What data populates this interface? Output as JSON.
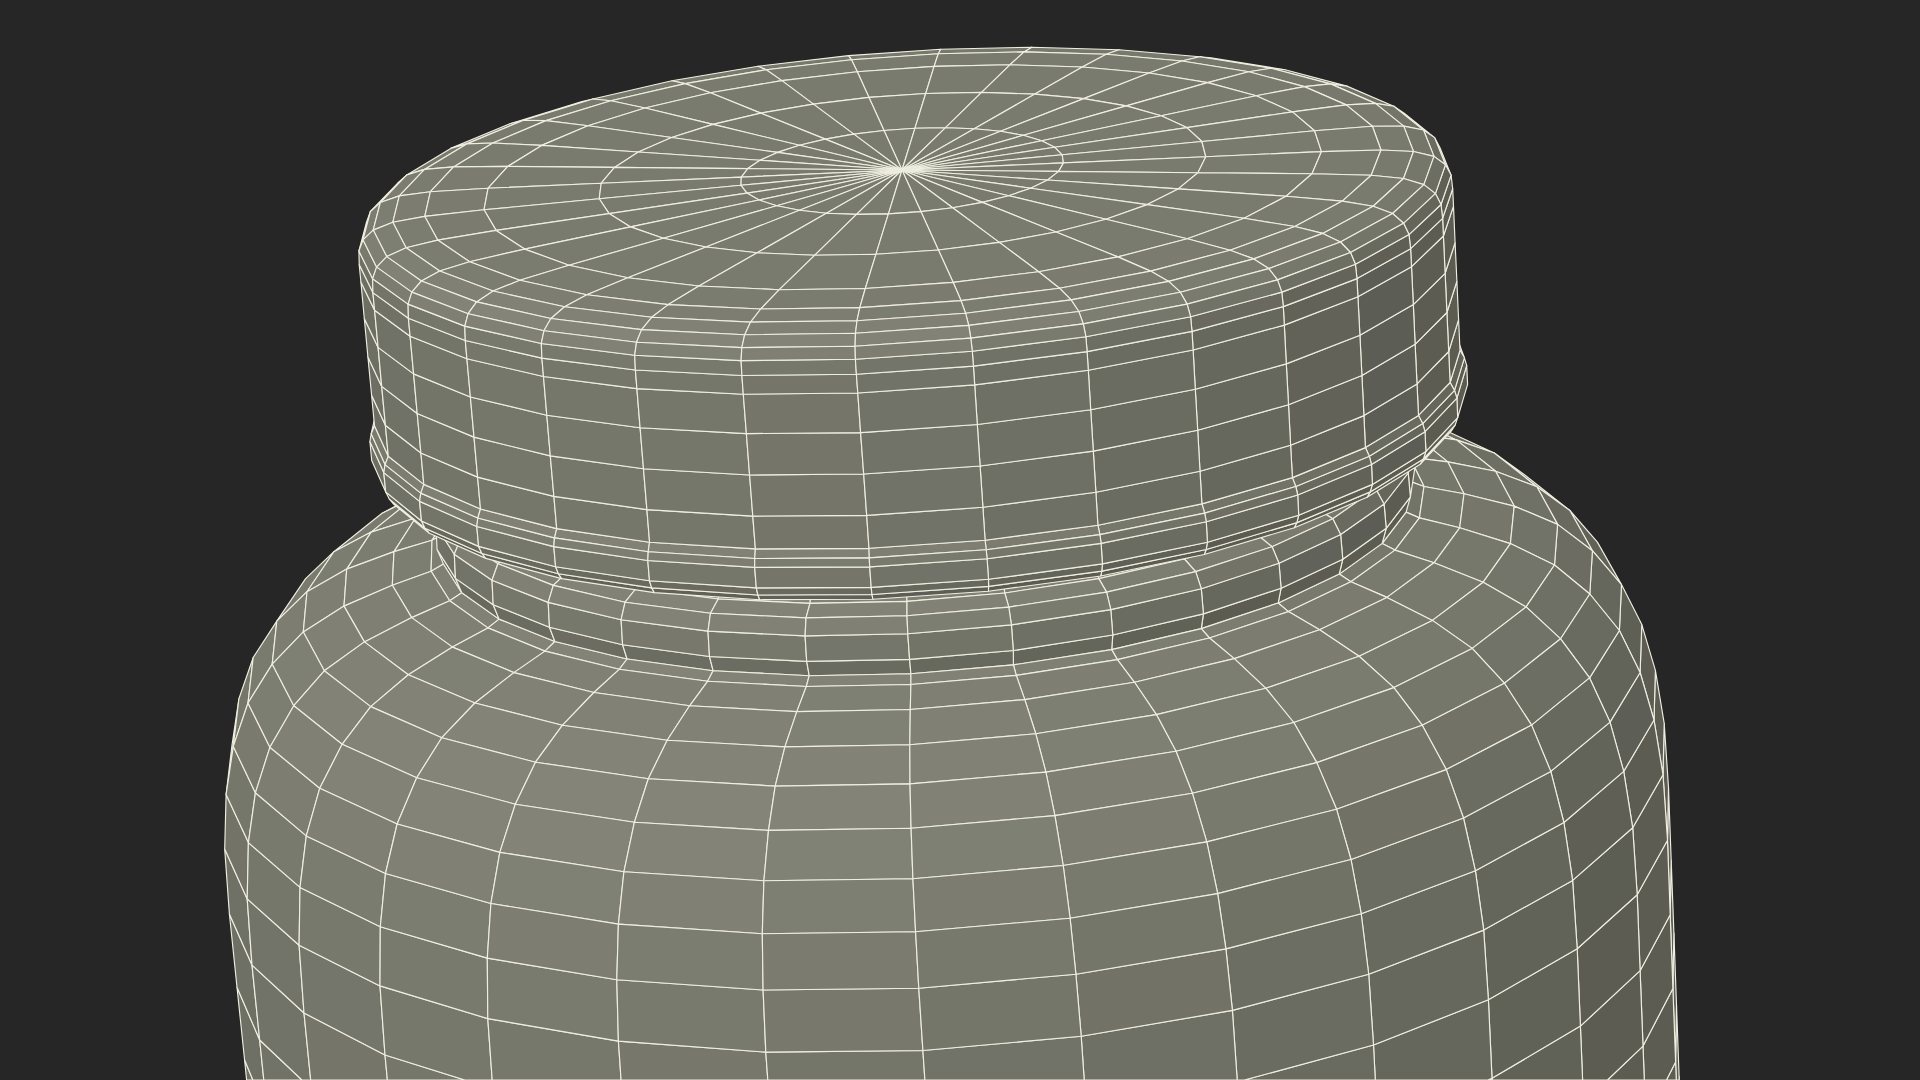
{
  "scene": {
    "objects": [
      {
        "kind": "jar"
      },
      {
        "kind": "lid"
      }
    ]
  }
}
